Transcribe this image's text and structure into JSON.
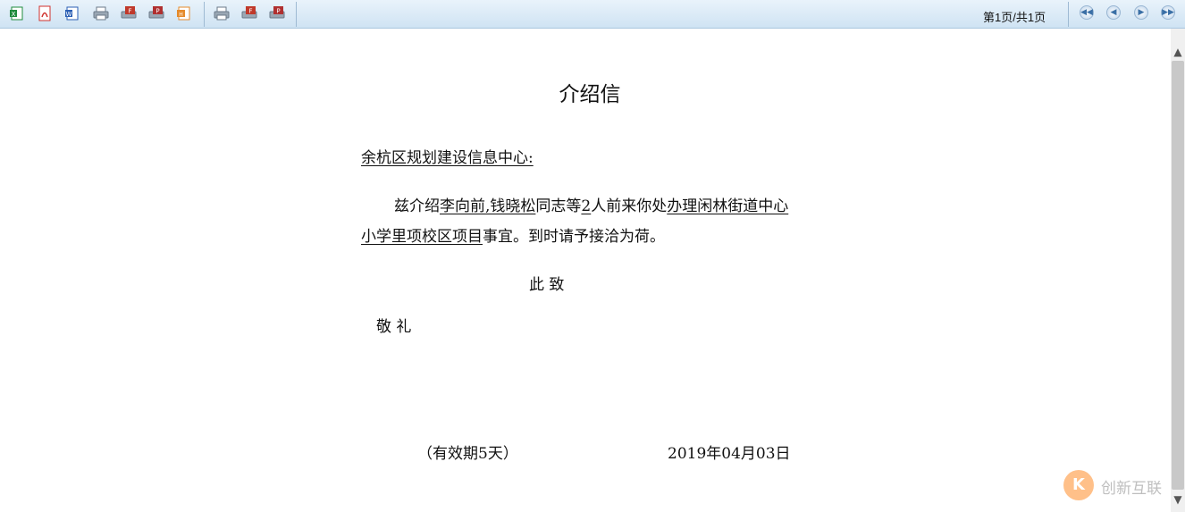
{
  "toolbar": {
    "buttons_group1": [
      {
        "name": "export-excel-button",
        "icon": "excel-icon",
        "color": "#1f8b3c"
      },
      {
        "name": "export-pdf-button",
        "icon": "pdf-icon",
        "color": "#d0312d"
      },
      {
        "name": "export-word-button",
        "icon": "word-icon",
        "color": "#2b5fb4"
      },
      {
        "name": "print-button",
        "icon": "printer-icon",
        "color": "#6b7a89"
      },
      {
        "name": "flash-print-button",
        "icon": "flash-print-icon",
        "color": "#c0392b"
      },
      {
        "name": "pdf-print-button",
        "icon": "pdf-print-icon",
        "color": "#b03030"
      },
      {
        "name": "export-html-button",
        "icon": "html-icon",
        "color": "#e58a2b"
      }
    ],
    "buttons_group2": [
      {
        "name": "print-all-button",
        "icon": "printer-icon",
        "color": "#6b7a89"
      },
      {
        "name": "flash-print-all-button",
        "icon": "flash-print-icon",
        "color": "#c0392b"
      },
      {
        "name": "pdf-print-all-button",
        "icon": "pdf-print-icon",
        "color": "#b03030"
      }
    ],
    "page_info": "第1页/共1页",
    "nav": {
      "first": "first-page-icon",
      "prev": "prev-page-icon",
      "next": "next-page-icon",
      "last": "last-page-icon"
    }
  },
  "letter": {
    "title": "介绍信",
    "recipient": "余杭区规划建设信息中心:",
    "body_prefix": "兹介绍",
    "persons": "李向前,钱晓松",
    "body_mid1": "同志等",
    "count": "2",
    "body_mid2": "人前来你处",
    "matter_line1": "办理闲林街道中心",
    "matter_line2": "小学里项校区项目",
    "body_suffix": "事宜。到时请予接洽为荷。",
    "closing1": "此 致",
    "closing2": "敬 礼",
    "validity": "（有效期5天）",
    "date": "2019年04月03日"
  },
  "watermark": {
    "logo_letter": "K",
    "text": "创新互联",
    "color": "#ff8d2a"
  }
}
